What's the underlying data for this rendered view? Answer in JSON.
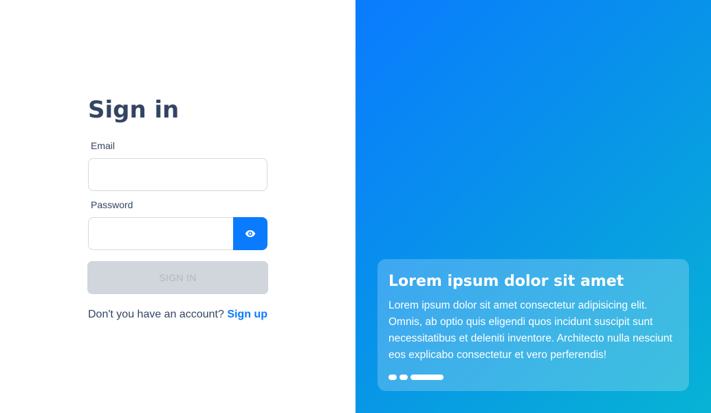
{
  "signin": {
    "title": "Sign in",
    "email_label": "Email",
    "email_value": "",
    "password_label": "Password",
    "password_value": "",
    "toggle_icon": "eye-icon",
    "submit_label": "SIGN IN",
    "submit_disabled": true,
    "signup_prompt": "Don't you have an account?",
    "signup_link": "Sign up"
  },
  "carousel": {
    "title": "Lorem ipsum dolor sit amet",
    "text": "Lorem ipsum dolor sit amet consectetur adipisicing elit. Omnis, ab optio quis eligendi quos incidunt suscipit sunt necessitatibus et deleniti inventore. Architecto nulla nesciunt eos explicabo consectetur et vero perferendis!",
    "slide_count": 3,
    "active_slide": 3
  },
  "colors": {
    "accent": "#0a7bff",
    "heading": "#344563",
    "gradient_start": "#0a7bff",
    "gradient_end": "#07b3d4",
    "disabled_button": "#d1d5dc"
  }
}
